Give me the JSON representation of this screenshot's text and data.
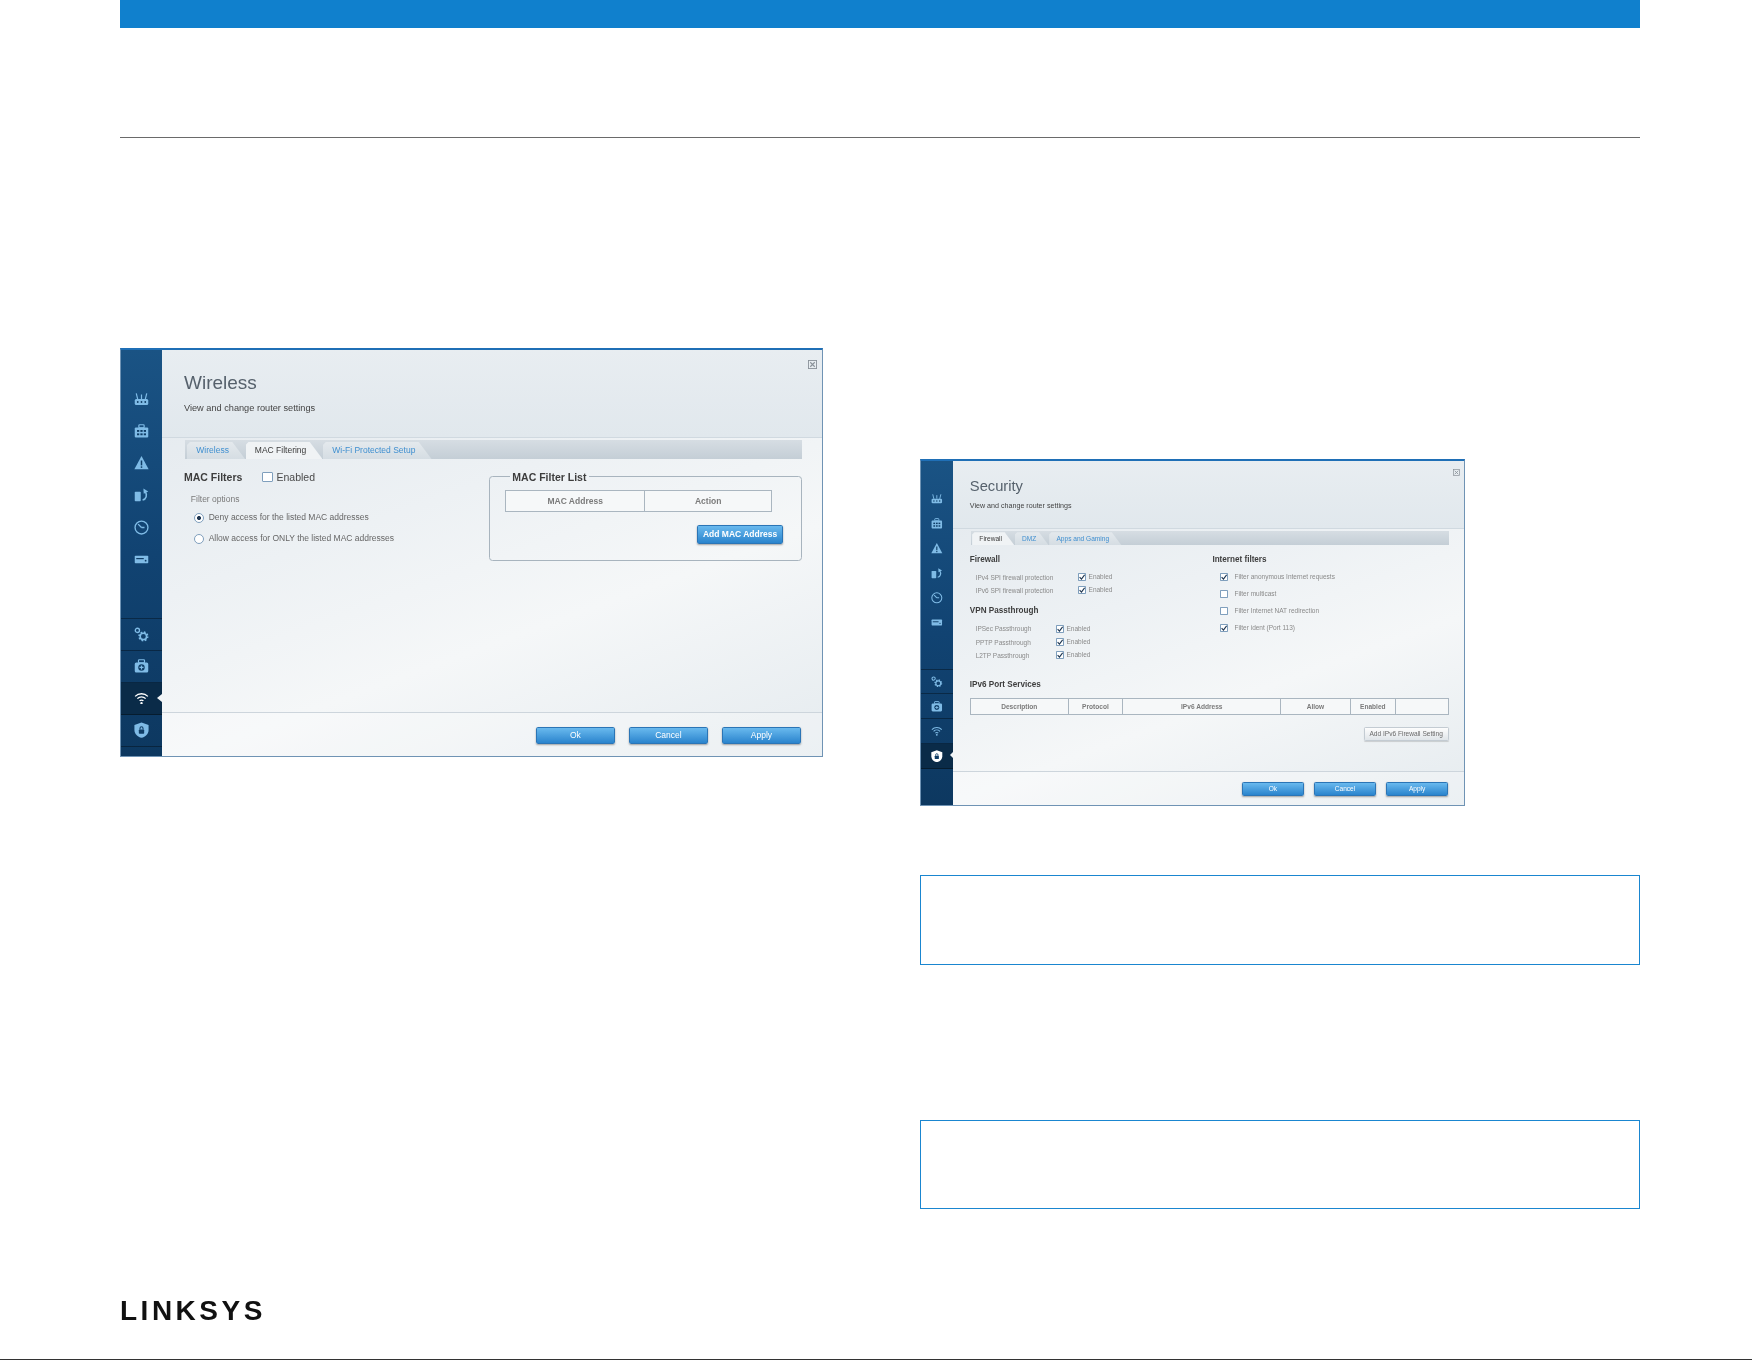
{
  "left_column": {
    "screenshot": {
      "title": "Wireless",
      "subtitle": "View and change router settings",
      "sidebar": {
        "top_items": [
          {
            "selected": false
          },
          {
            "selected": false
          },
          {
            "selected": false
          },
          {
            "selected": false
          },
          {
            "selected": false
          },
          {
            "selected": false
          }
        ],
        "bottom_items": [
          {
            "selected": false
          },
          {
            "selected": false
          },
          {
            "selected": true
          },
          {
            "selected": false
          }
        ]
      },
      "tabs": [
        {
          "label": "Wireless",
          "selected": false
        },
        {
          "label": "MAC Filtering",
          "selected": true
        },
        {
          "label": "Wi-Fi Protected Setup",
          "selected": false
        }
      ],
      "left_sections": [
        {
          "kind": "toggle_options",
          "heading": "MAC Filters",
          "toggle": {
            "label": "Enabled",
            "checked": false
          },
          "group_label": "Filter options",
          "options": [
            {
              "label": "Deny access for the listed MAC addresses",
              "selected": true
            },
            {
              "label": "Allow access for ONLY the listed MAC addresses",
              "selected": false
            }
          ]
        }
      ],
      "right_sections": [
        {
          "kind": "fieldset_table",
          "legend": "MAC Filter List",
          "columns": [
            "MAC Address",
            "Action"
          ],
          "button": "Add MAC Address"
        }
      ],
      "footer_buttons": [
        "Ok",
        "Cancel",
        "Apply"
      ]
    }
  },
  "right_column": {
    "screenshot": {
      "title": "Security",
      "subtitle": "View and change router settings",
      "sidebar": {
        "top_items": [
          {
            "selected": false
          },
          {
            "selected": false
          },
          {
            "selected": false
          },
          {
            "selected": false
          },
          {
            "selected": false
          },
          {
            "selected": false
          }
        ],
        "bottom_items": [
          {
            "selected": false
          },
          {
            "selected": false
          },
          {
            "selected": false
          },
          {
            "selected": true
          }
        ]
      },
      "tabs": [
        {
          "label": "Firewall",
          "selected": true
        },
        {
          "label": "DMZ",
          "selected": false
        },
        {
          "label": "Apps and Gaming",
          "selected": false
        }
      ],
      "left_sections": [
        {
          "kind": "checklist",
          "heading": "Firewall",
          "rows": [
            {
              "label": "IPv4 SPI firewall protection",
              "option": "Enabled",
              "checked": true
            },
            {
              "label": "IPv6 SPI firewall protection",
              "option": "Enabled",
              "checked": true
            }
          ]
        },
        {
          "kind": "checklist",
          "heading": "VPN Passthrough",
          "rows": [
            {
              "label": "IPSec Passthrough",
              "option": "Enabled",
              "checked": true
            },
            {
              "label": "PPTP Passthrough",
              "option": "Enabled",
              "checked": true
            },
            {
              "label": "L2TP Passthrough",
              "option": "Enabled",
              "checked": true
            }
          ]
        }
      ],
      "right_sections": [
        {
          "kind": "filter_list",
          "heading": "Internet filters",
          "items": [
            {
              "label": "Filter anonymous Internet requests",
              "checked": true
            },
            {
              "label": "Filter multicast",
              "checked": false
            },
            {
              "label": "Filter Internet NAT redirection",
              "checked": false
            },
            {
              "label": "Filter ident (Port 113)",
              "checked": true
            }
          ]
        }
      ],
      "wide_sections": [
        {
          "kind": "table",
          "heading": "IPv6 Port Services",
          "columns": [
            "Description",
            "Protocol",
            "IPv6 Address",
            "Allow",
            "Enabled"
          ],
          "trailing_blank_column": true,
          "button": "Add IPv6 Firewall Setting"
        }
      ],
      "footer_buttons": [
        "Ok",
        "Cancel",
        "Apply"
      ]
    }
  },
  "brand": "LINKSYS"
}
